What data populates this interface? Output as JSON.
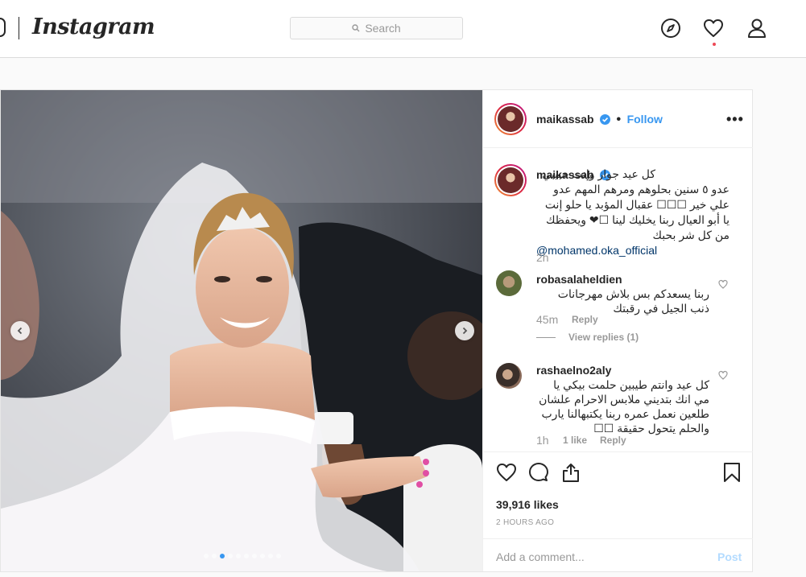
{
  "nav": {
    "logo": "Instagram",
    "search_placeholder": "Search",
    "icons": [
      "camera-icon",
      "compass-icon",
      "heart-icon",
      "profile-icon"
    ]
  },
  "post": {
    "username": "maikassab",
    "follow_label": "Follow",
    "carousel": {
      "count": 10,
      "active_index": 2
    },
    "caption": {
      "username": "maikassab",
      "text": "كل عيد جواز وإنت حبيبي عدو ٥ سنين بحلوهم ومرهم المهم عدو علي خير ☐☐☐ عقبال المؤبد يا حلو إنت يا أبو العيال ربنا يخليك لينا ☐❤ ويحفظك من كل شر بحبك",
      "mention": "@mohamed.oka_official",
      "time": "2h"
    },
    "comments": [
      {
        "username": "robasalaheldien",
        "text": "ربنا يسعدكم بس بلاش مهرجانات ذنب الجيل في رقبتك",
        "time": "45m",
        "reply_label": "Reply",
        "view_replies": "View replies (1)"
      },
      {
        "username": "rashaelno2aly",
        "text": "كل عيد وانتم طيبين حلمت بيكي يا مي انك بتديني ملابس الاحرام علشان طلعين نعمل عمره ربنا يكتبهالنا يارب والحلم يتحول حقيقة ☐☐",
        "time": "1h",
        "likes": "1 like",
        "reply_label": "Reply"
      }
    ],
    "likes": "39,916 likes",
    "time_ago": "2 HOURS AGO",
    "add_comment_placeholder": "Add a comment...",
    "post_button": "Post"
  },
  "colors": {
    "accent": "#3897f0",
    "notification_dot": "#ed4956",
    "mention": "#003569"
  }
}
